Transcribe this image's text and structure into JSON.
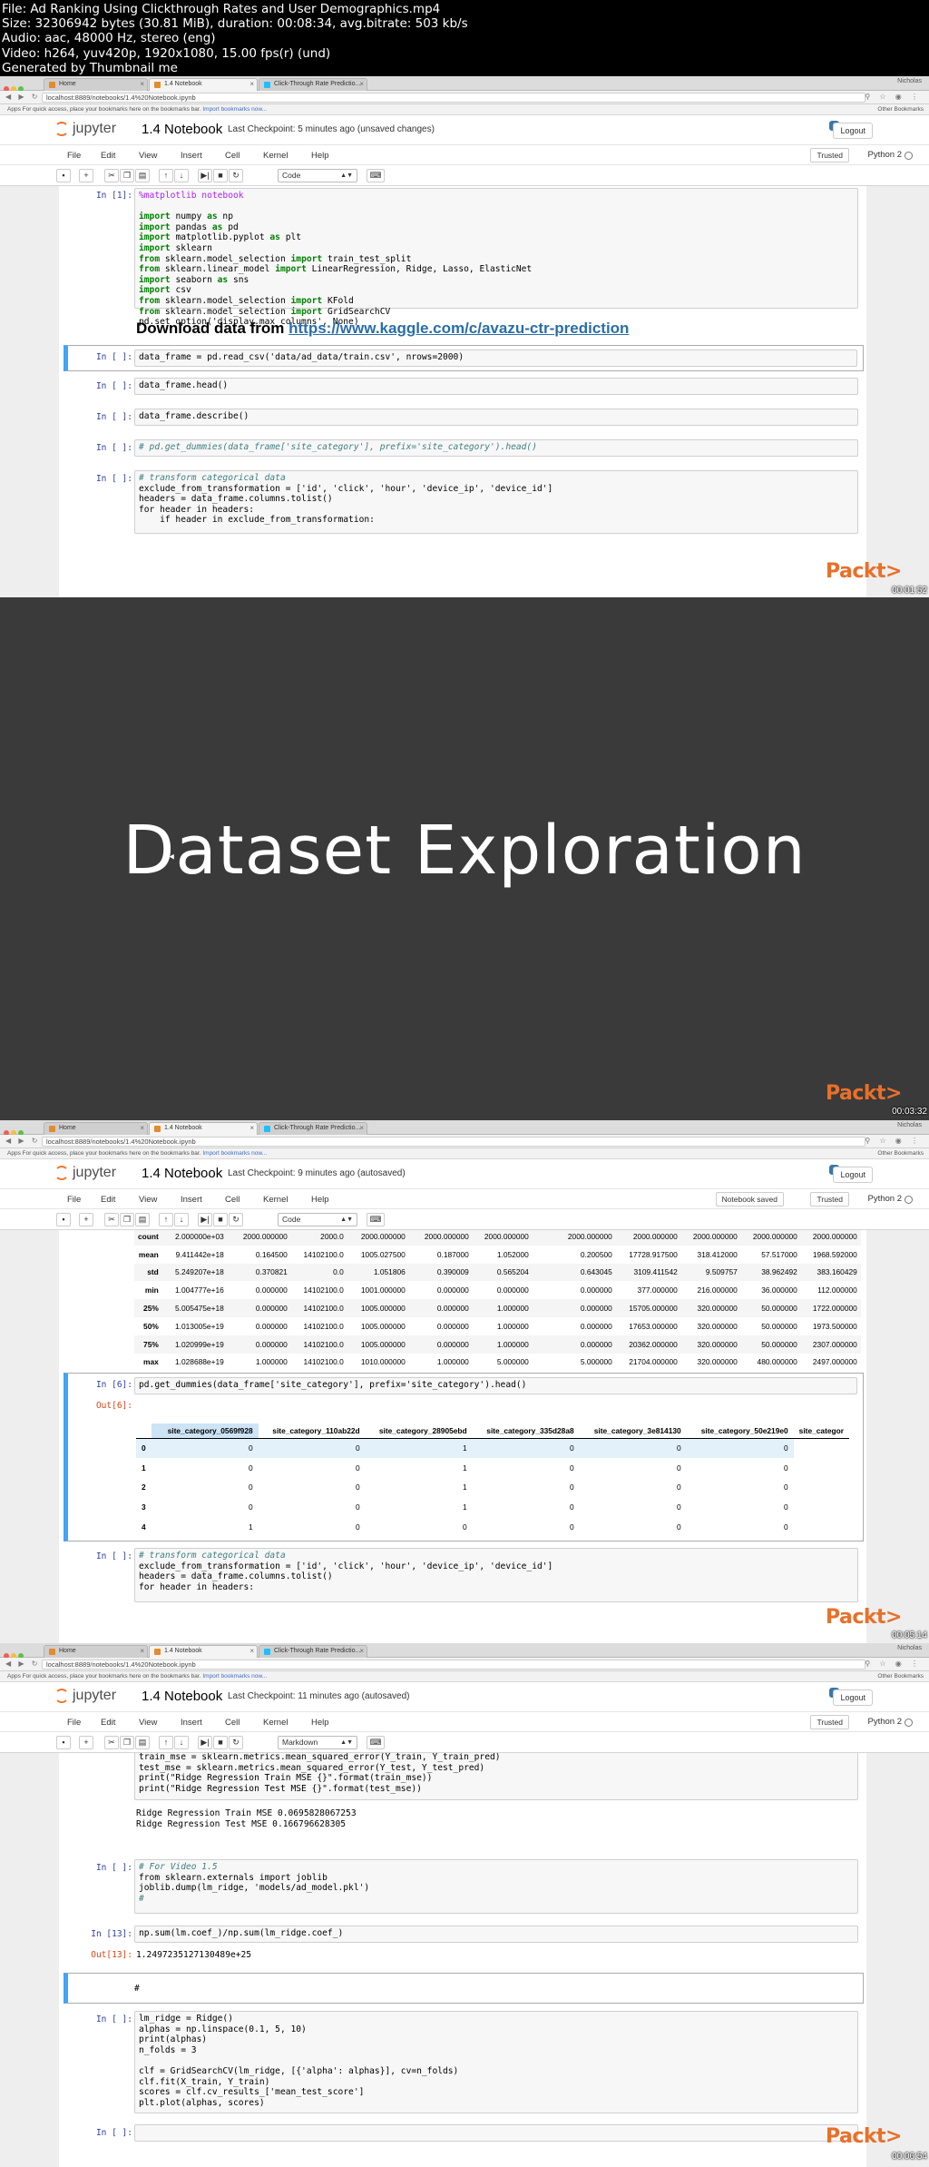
{
  "meta_lines": {
    "file": "File: Ad Ranking Using Clickthrough Rates and User Demographics.mp4",
    "size": "Size: 32306942 bytes (30.81 MiB), duration: 00:08:34, avg.bitrate: 503 kb/s",
    "audio": "Audio: aac, 48000 Hz, stereo (eng)",
    "video": "Video: h264, yuv420p, 1920x1080, 15.00 fps(r) (und)",
    "generated": "Generated by Thumbnail me"
  },
  "browser": {
    "tabs": [
      "Home",
      "1.4 Notebook",
      "Click-Through Rate Predictio..."
    ],
    "user": "Nicholas",
    "url": "localhost:8889/notebooks/1.4%20Notebook.ipynb",
    "bookmarks_text": "Apps   For quick access, place your bookmarks here on the bookmarks bar.",
    "bookmarks_link": "Import bookmarks now...",
    "other_bookmarks": "Other Bookmarks"
  },
  "jupyter": {
    "logo": "jupyter",
    "notebook_title": "1.4 Notebook",
    "logout": "Logout",
    "trusted": "Trusted",
    "kernel": "Python 2",
    "notebook_saved": "Notebook saved",
    "menu": [
      "File",
      "Edit",
      "View",
      "Insert",
      "Cell",
      "Kernel",
      "Help"
    ]
  },
  "frame1": {
    "checkpoint": "Last Checkpoint: 5 minutes ago (unsaved changes)",
    "cell_type": "Code",
    "cell1_prompt": "In [1]:",
    "cell1_code": [
      "%matplotlib notebook",
      "",
      "import numpy as np",
      "import pandas as pd",
      "import matplotlib.pyplot as plt",
      "import sklearn",
      "from sklearn.model_selection import train_test_split",
      "from sklearn.linear_model import LinearRegression, Ridge, Lasso, ElasticNet",
      "import seaborn as sns",
      "import csv",
      "from sklearn.model_selection import KFold",
      "from sklearn.model_selection import GridSearchCV",
      "pd.set_option('display.max_columns', None)"
    ],
    "md_prefix": "Download data from ",
    "md_link": "https://www.kaggle.com/c/avazu-ctr-prediction",
    "cells": [
      {
        "prompt": "In [ ]:",
        "code": "data_frame = pd.read_csv('data/ad_data/train.csv', nrows=2000)"
      },
      {
        "prompt": "In [ ]:",
        "code": "data_frame.head()"
      },
      {
        "prompt": "In [ ]:",
        "code": "data_frame.describe()"
      },
      {
        "prompt": "In [ ]:",
        "code": "# pd.get_dummies(data_frame['site_category'], prefix='site_category').head()"
      }
    ],
    "last_prompt": "In [ ]:",
    "last_code": [
      "# transform categorical data",
      "exclude_from_transformation = ['id', 'click', 'hour', 'device_ip', 'device_id']",
      "headers = data_frame.columns.tolist()",
      "for header in headers:",
      "    if header in exclude_from_transformation:"
    ],
    "timestamp": "00:01:52"
  },
  "frame2": {
    "title": "Dataset Exploration",
    "timestamp": "00:03:32"
  },
  "frame3": {
    "checkpoint": "Last Checkpoint: 9 minutes ago (autosaved)",
    "cell_type": "Code",
    "stats_rows": [
      [
        "count",
        "2.000000e+03",
        "2000.000000",
        "2000.0",
        "2000.000000",
        "2000.000000",
        "2000.000000",
        "2000.000000",
        "2000.000000",
        "2000.000000",
        "2000.000000",
        "2000.000000"
      ],
      [
        "mean",
        "9.411442e+18",
        "0.164500",
        "14102100.0",
        "1005.027500",
        "0.187000",
        "1.052000",
        "0.200500",
        "17728.917500",
        "318.412000",
        "57.517000",
        "1968.592000"
      ],
      [
        "std",
        "5.249207e+18",
        "0.370821",
        "0.0",
        "1.051806",
        "0.390009",
        "0.565204",
        "0.643045",
        "3109.411542",
        "9.509757",
        "38.962492",
        "383.160429"
      ],
      [
        "min",
        "1.004777e+16",
        "0.000000",
        "14102100.0",
        "1001.000000",
        "0.000000",
        "0.000000",
        "0.000000",
        "377.000000",
        "216.000000",
        "36.000000",
        "112.000000"
      ],
      [
        "25%",
        "5.005475e+18",
        "0.000000",
        "14102100.0",
        "1005.000000",
        "0.000000",
        "1.000000",
        "0.000000",
        "15705.000000",
        "320.000000",
        "50.000000",
        "1722.000000"
      ],
      [
        "50%",
        "1.013005e+19",
        "0.000000",
        "14102100.0",
        "1005.000000",
        "0.000000",
        "1.000000",
        "0.000000",
        "17653.000000",
        "320.000000",
        "50.000000",
        "1973.500000"
      ],
      [
        "75%",
        "1.020999e+19",
        "0.000000",
        "14102100.0",
        "1005.000000",
        "0.000000",
        "1.000000",
        "0.000000",
        "20362.000000",
        "320.000000",
        "50.000000",
        "2307.000000"
      ],
      [
        "max",
        "1.028688e+19",
        "1.000000",
        "14102100.0",
        "1010.000000",
        "1.000000",
        "5.000000",
        "5.000000",
        "21704.000000",
        "320.000000",
        "480.000000",
        "2497.000000"
      ]
    ],
    "cell6_prompt": "In [6]:",
    "cell6_code": "pd.get_dummies(data_frame['site_category'], prefix='site_category').head()",
    "out6_prompt": "Out[6]:",
    "dummies_headers": [
      "",
      "site_category_0569f928",
      "site_category_110ab22d",
      "site_category_28905ebd",
      "site_category_335d28a8",
      "site_category_3e814130",
      "site_category_50e219e0",
      "site_categor"
    ],
    "dummies_rows": [
      [
        "0",
        "0",
        "0",
        "1",
        "0",
        "0",
        "0"
      ],
      [
        "1",
        "0",
        "0",
        "1",
        "0",
        "0",
        "0"
      ],
      [
        "2",
        "0",
        "0",
        "1",
        "0",
        "0",
        "0"
      ],
      [
        "3",
        "0",
        "0",
        "1",
        "0",
        "0",
        "0"
      ],
      [
        "4",
        "1",
        "0",
        "0",
        "0",
        "0",
        "0"
      ]
    ],
    "last_prompt": "In [ ]:",
    "last_code": [
      "# transform categorical data",
      "exclude_from_transformation = ['id', 'click', 'hour', 'device_ip', 'device_id']",
      "headers = data_frame.columns.tolist()",
      "for header in headers:"
    ],
    "timestamp": "00:05:14"
  },
  "frame4": {
    "checkpoint": "Last Checkpoint: 11 minutes ago (autosaved)",
    "cell_type": "Markdown",
    "top_code": [
      "train_mse = sklearn.metrics.mean_squared_error(Y_train, Y_train_pred)",
      "test_mse = sklearn.metrics.mean_squared_error(Y_test, Y_test_pred)",
      "print(\"Ridge Regression Train MSE {}\".format(train_mse))",
      "print(\"Ridge Regression Test MSE {}\".format(test_mse))"
    ],
    "top_output": [
      "Ridge Regression Train MSE 0.0695828067253",
      "Ridge Regression Test MSE 0.166796628305"
    ],
    "video_prompt": "In [ ]:",
    "video_code": [
      "# For Video 1.5",
      "from sklearn.externals import joblib",
      "joblib.dump(lm_ridge, 'models/ad_model.pkl')",
      "#"
    ],
    "in13_prompt": "In [13]:",
    "in13_code": "np.sum(lm.coef_)/np.sum(lm_ridge.coef_)",
    "out13_prompt": "Out[13]:",
    "out13_value": "1.2497235127130489e+25",
    "md_cell_text": "#",
    "ridge_prompt": "In [ ]:",
    "ridge_code": [
      "lm_ridge = Ridge()",
      "alphas = np.linspace(0.1, 5, 10)",
      "print(alphas)",
      "n_folds = 3",
      "",
      "clf = GridSearchCV(lm_ridge, [{'alpha': alphas}], cv=n_folds)",
      "clf.fit(X_train, Y_train)",
      "scores = clf.cv_results_['mean_test_score']",
      "plt.plot(alphas, scores)"
    ],
    "empty_prompt": "In [ ]:",
    "timestamp": "00:06:54"
  },
  "watermark": "Packt>",
  "colors": {
    "jupyter_orange": "#f37626",
    "packt_orange": "#e8702a",
    "prompt_in": "#303f9f",
    "prompt_out": "#d84315",
    "selected_cell": "#42a5f5",
    "link_blue": "#296eaa"
  }
}
